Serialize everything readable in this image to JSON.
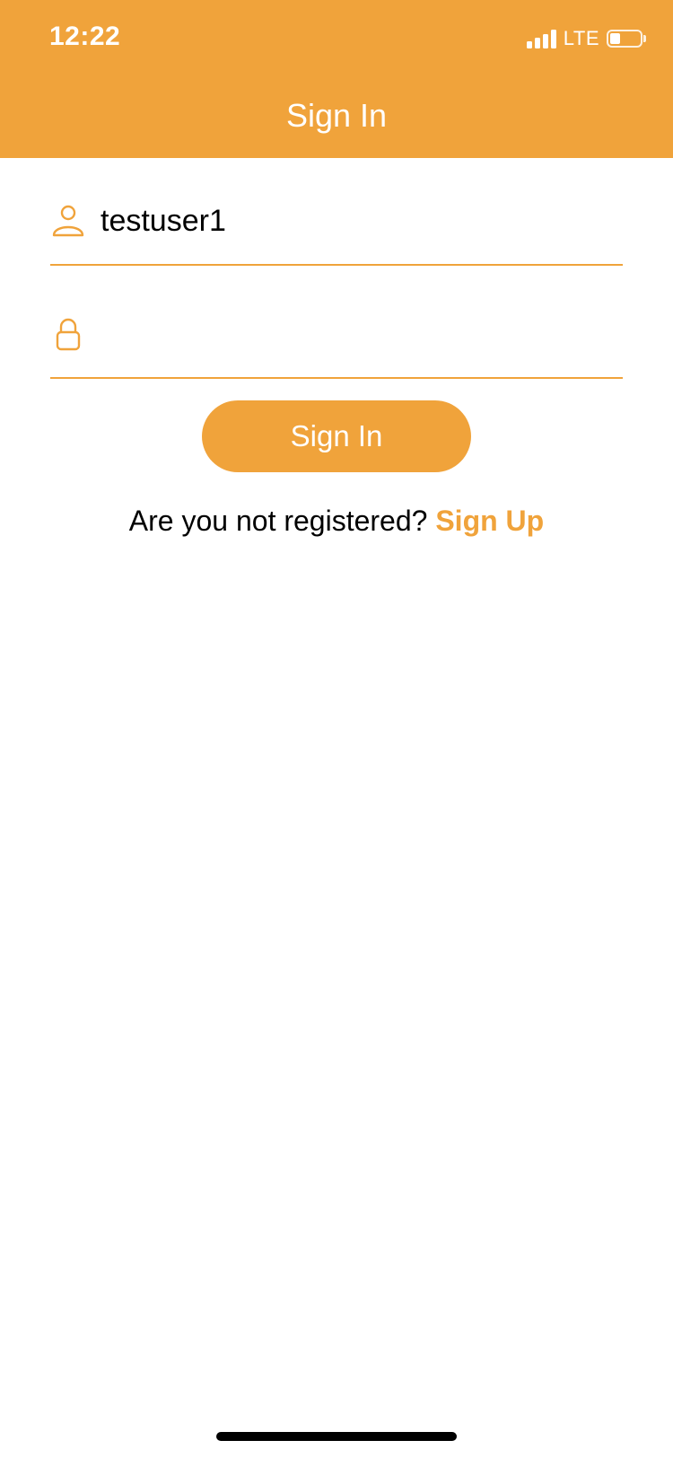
{
  "status_bar": {
    "time": "12:22",
    "network": "LTE",
    "battery_level": 0.35
  },
  "nav": {
    "title": "Sign In"
  },
  "form": {
    "username": {
      "value": "testuser1",
      "icon": "person-icon"
    },
    "password": {
      "value": "",
      "icon": "lock-icon"
    },
    "submit_label": "Sign In"
  },
  "register": {
    "prompt": "Are you not registered?",
    "link_label": "Sign Up"
  },
  "colors": {
    "accent": "#F0A33B",
    "text": "#000000",
    "background": "#FFFFFF"
  }
}
